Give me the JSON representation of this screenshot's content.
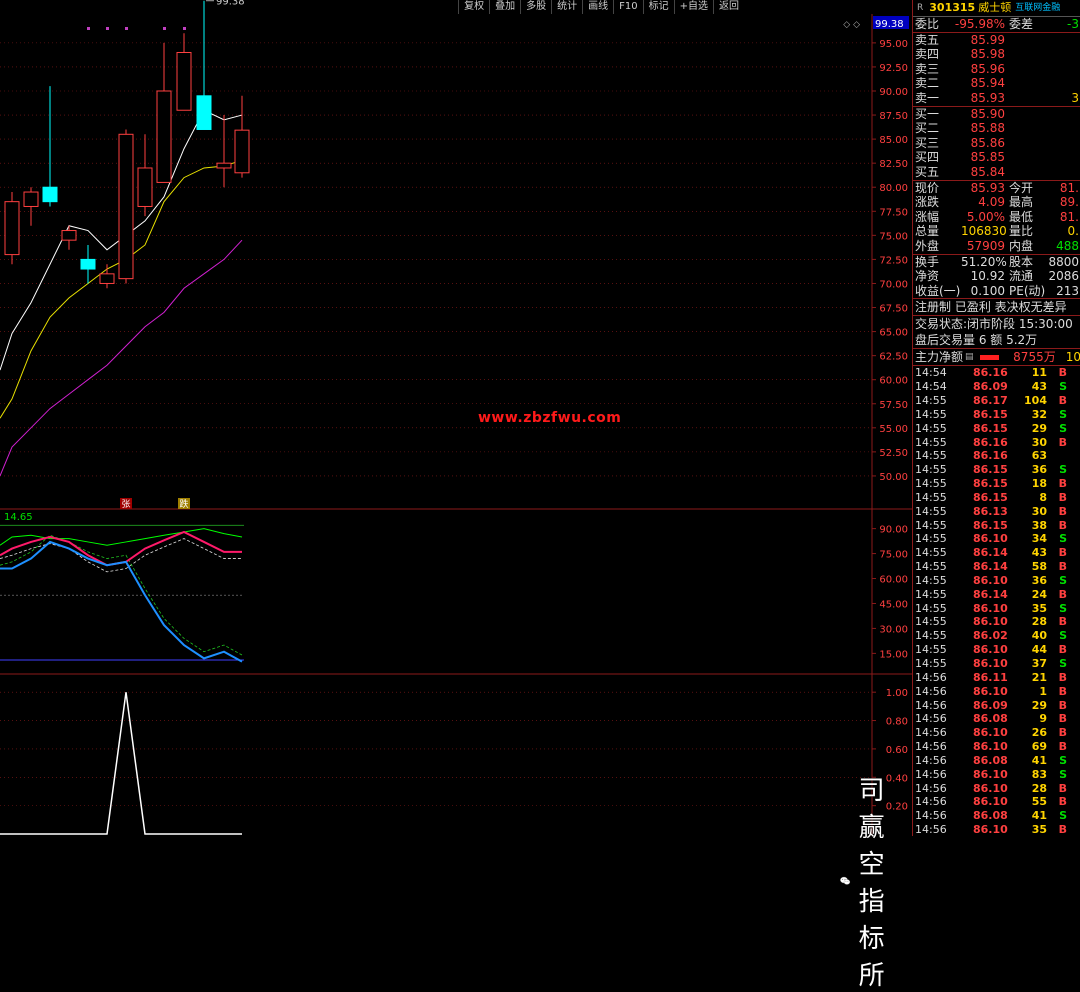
{
  "toolbar": [
    "复权",
    "叠加",
    "多股",
    "统计",
    "画线",
    "F10",
    "标记",
    "+自选",
    "返回"
  ],
  "watermark_text": "www.zbzfwu.com",
  "brand_text": "司赢空指标所",
  "colors": {
    "up": "#ff4040",
    "down": "#00ffff",
    "ma_white": "#ffffff",
    "ma_yellow": "#e8e000",
    "ma_magenta": "#d020d0",
    "grid": "#8b1a1a",
    "k_line": "#ff1a6a",
    "d_line": "#00ff00",
    "j_line": "#1e90ff",
    "dash": "#e0e0e0"
  },
  "chart_data": [
    {
      "type": "candlestick",
      "y_ticks": [
        "95.00",
        "92.50",
        "90.00",
        "87.50",
        "85.00",
        "82.50",
        "80.00",
        "77.50",
        "75.00",
        "72.50",
        "70.00",
        "67.50",
        "65.00",
        "62.50",
        "60.00",
        "57.50",
        "55.00",
        "52.50",
        "50.00"
      ],
      "ylim": [
        47.5,
        98.0
      ],
      "current_price_label": "99.38",
      "peak_label": "99.38",
      "candles": [
        {
          "o": 73.0,
          "h": 79.5,
          "l": 72.0,
          "c": 78.5
        },
        {
          "o": 78.0,
          "h": 80.0,
          "l": 76.0,
          "c": 79.5
        },
        {
          "o": 80.0,
          "h": 90.5,
          "l": 78.0,
          "c": 78.5
        },
        {
          "o": 74.5,
          "h": 76.0,
          "l": 73.5,
          "c": 75.5
        },
        {
          "o": 72.5,
          "h": 74.0,
          "l": 70.0,
          "c": 71.5
        },
        {
          "o": 70.0,
          "h": 72.0,
          "l": 69.5,
          "c": 71.0
        },
        {
          "o": 70.5,
          "h": 86.0,
          "l": 70.0,
          "c": 85.5
        },
        {
          "o": 78.0,
          "h": 85.5,
          "l": 77.0,
          "c": 82.0
        },
        {
          "o": 80.5,
          "h": 95.0,
          "l": 80.5,
          "c": 90.0
        },
        {
          "o": 88.0,
          "h": 96.0,
          "l": 88.0,
          "c": 94.0
        },
        {
          "o": 89.5,
          "h": 99.38,
          "l": 86.0,
          "c": 86.0
        },
        {
          "o": 82.0,
          "h": 87.5,
          "l": 80.0,
          "c": 82.5
        },
        {
          "o": 81.5,
          "h": 89.5,
          "l": 81.0,
          "c": 85.93
        }
      ],
      "ma_white": [
        64.8,
        68.0,
        72.0,
        76.0,
        75.5,
        73.5,
        75.0,
        76.5,
        79.0,
        84.0,
        88.0,
        87.0,
        87.5
      ],
      "ma_yellow": [
        58.0,
        63.0,
        66.5,
        68.5,
        70.0,
        71.5,
        72.5,
        74.0,
        78.5,
        81.0,
        82.0,
        82.2,
        82.8
      ],
      "ma_magenta": [
        53.0,
        55.0,
        57.0,
        58.5,
        60.0,
        61.5,
        63.5,
        65.5,
        67.0,
        69.5,
        71.0,
        72.5,
        74.5
      ],
      "markers": [
        "张",
        "跌"
      ]
    },
    {
      "type": "line",
      "title": "14.65",
      "y_ticks": [
        "90.00",
        "75.00",
        "60.00",
        "45.00",
        "30.00",
        "15.00"
      ],
      "ylim": [
        5,
        100
      ],
      "series": [
        {
          "values": [
            78,
            82,
            85,
            82,
            74,
            68,
            70,
            78,
            83,
            88,
            82,
            76,
            76
          ]
        },
        {
          "values": [
            85,
            86,
            84,
            84,
            82,
            80,
            82,
            84,
            86,
            88,
            90,
            87,
            85
          ]
        },
        {
          "values": [
            66,
            72,
            82,
            78,
            72,
            68,
            70,
            50,
            32,
            20,
            12,
            16,
            10
          ]
        }
      ]
    },
    {
      "type": "line",
      "y_ticks": [
        "1.00",
        "0.80",
        "0.60",
        "0.40",
        "0.20"
      ],
      "ylim": [
        0,
        1.1
      ],
      "series": [
        {
          "values": [
            0,
            0,
            0,
            0,
            0,
            0,
            1,
            0,
            0,
            0,
            0,
            0,
            0
          ]
        }
      ]
    }
  ],
  "quote": {
    "r_badge": "R",
    "code": "301315",
    "name": "威士顿",
    "tag": "互联网金融",
    "weibi_label": "委比",
    "weibi_value": "-95.98%",
    "weicha_label": "委差",
    "weicha_value": "-3",
    "asks": [
      {
        "label": "卖五",
        "price": "85.99",
        "vol": ""
      },
      {
        "label": "卖四",
        "price": "85.98",
        "vol": ""
      },
      {
        "label": "卖三",
        "price": "85.96",
        "vol": ""
      },
      {
        "label": "卖二",
        "price": "85.94",
        "vol": ""
      },
      {
        "label": "卖一",
        "price": "85.93",
        "vol": "3"
      }
    ],
    "bids": [
      {
        "label": "买一",
        "price": "85.90",
        "vol": ""
      },
      {
        "label": "买二",
        "price": "85.88",
        "vol": ""
      },
      {
        "label": "买三",
        "price": "85.86",
        "vol": ""
      },
      {
        "label": "买四",
        "price": "85.85",
        "vol": ""
      },
      {
        "label": "买五",
        "price": "85.84",
        "vol": ""
      }
    ],
    "stats": [
      {
        "l1": "现价",
        "v1": "85.93",
        "c1": "red",
        "l2": "今开",
        "v2": "81.",
        "c2": "red"
      },
      {
        "l1": "涨跌",
        "v1": "4.09",
        "c1": "red",
        "l2": "最高",
        "v2": "89.",
        "c2": "red"
      },
      {
        "l1": "涨幅",
        "v1": "5.00%",
        "c1": "red",
        "l2": "最低",
        "v2": "81.",
        "c2": "red"
      },
      {
        "l1": "总量",
        "v1": "106830",
        "c1": "yel",
        "l2": "量比",
        "v2": "0.",
        "c2": "yel"
      },
      {
        "l1": "外盘",
        "v1": "57909",
        "c1": "red",
        "l2": "内盘",
        "v2": "488",
        "c2": "grn"
      }
    ],
    "stats2": [
      {
        "l1": "换手",
        "v1": "51.20%",
        "c1": "wht",
        "l2": "股本",
        "v2": "8800",
        "c2": "wht"
      },
      {
        "l1": "净资",
        "v1": "10.92",
        "c1": "wht",
        "l2": "流通",
        "v2": "2086",
        "c2": "wht"
      },
      {
        "l1": "收益(一)",
        "v1": "0.100",
        "c1": "wht",
        "l2": "PE(动)",
        "v2": "213",
        "c2": "wht"
      }
    ],
    "info_line": "注册制 已盈利 表决权无差异",
    "status_line": "交易状态:闭市阶段 15:30:00",
    "after_line": "盘后交易量 6 额 5.2万",
    "flow_label": "主力净额",
    "flow_value": "8755万",
    "flow_tail": "10"
  },
  "ticks": [
    {
      "t": "14:54",
      "p": "86.16",
      "v": "11",
      "s": "B"
    },
    {
      "t": "14:54",
      "p": "86.09",
      "v": "43",
      "s": "S"
    },
    {
      "t": "14:55",
      "p": "86.17",
      "v": "104",
      "s": "B"
    },
    {
      "t": "14:55",
      "p": "86.15",
      "v": "32",
      "s": "S"
    },
    {
      "t": "14:55",
      "p": "86.15",
      "v": "29",
      "s": "S"
    },
    {
      "t": "14:55",
      "p": "86.16",
      "v": "30",
      "s": "B"
    },
    {
      "t": "14:55",
      "p": "86.16",
      "v": "63",
      "s": ""
    },
    {
      "t": "14:55",
      "p": "86.15",
      "v": "36",
      "s": "S"
    },
    {
      "t": "14:55",
      "p": "86.15",
      "v": "18",
      "s": "B"
    },
    {
      "t": "14:55",
      "p": "86.15",
      "v": "8",
      "s": "B"
    },
    {
      "t": "14:55",
      "p": "86.13",
      "v": "30",
      "s": "B"
    },
    {
      "t": "14:55",
      "p": "86.15",
      "v": "38",
      "s": "B"
    },
    {
      "t": "14:55",
      "p": "86.10",
      "v": "34",
      "s": "S"
    },
    {
      "t": "14:55",
      "p": "86.14",
      "v": "43",
      "s": "B"
    },
    {
      "t": "14:55",
      "p": "86.14",
      "v": "58",
      "s": "B"
    },
    {
      "t": "14:55",
      "p": "86.10",
      "v": "36",
      "s": "S"
    },
    {
      "t": "14:55",
      "p": "86.14",
      "v": "24",
      "s": "B"
    },
    {
      "t": "14:55",
      "p": "86.10",
      "v": "35",
      "s": "S"
    },
    {
      "t": "14:55",
      "p": "86.10",
      "v": "28",
      "s": "B"
    },
    {
      "t": "14:55",
      "p": "86.02",
      "v": "40",
      "s": "S"
    },
    {
      "t": "14:55",
      "p": "86.10",
      "v": "44",
      "s": "B"
    },
    {
      "t": "14:55",
      "p": "86.10",
      "v": "37",
      "s": "S"
    },
    {
      "t": "14:56",
      "p": "86.11",
      "v": "21",
      "s": "B"
    },
    {
      "t": "14:56",
      "p": "86.10",
      "v": "1",
      "s": "B"
    },
    {
      "t": "14:56",
      "p": "86.09",
      "v": "29",
      "s": "B"
    },
    {
      "t": "14:56",
      "p": "86.08",
      "v": "9",
      "s": "B"
    },
    {
      "t": "14:56",
      "p": "86.10",
      "v": "26",
      "s": "B"
    },
    {
      "t": "14:56",
      "p": "86.10",
      "v": "69",
      "s": "B"
    },
    {
      "t": "14:56",
      "p": "86.08",
      "v": "41",
      "s": "S"
    },
    {
      "t": "14:56",
      "p": "86.10",
      "v": "83",
      "s": "S"
    },
    {
      "t": "14:56",
      "p": "86.10",
      "v": "28",
      "s": "B"
    },
    {
      "t": "14:56",
      "p": "86.10",
      "v": "55",
      "s": "B"
    },
    {
      "t": "14:56",
      "p": "86.08",
      "v": "41",
      "s": "S"
    },
    {
      "t": "14:56",
      "p": "86.10",
      "v": "35",
      "s": "B"
    }
  ]
}
